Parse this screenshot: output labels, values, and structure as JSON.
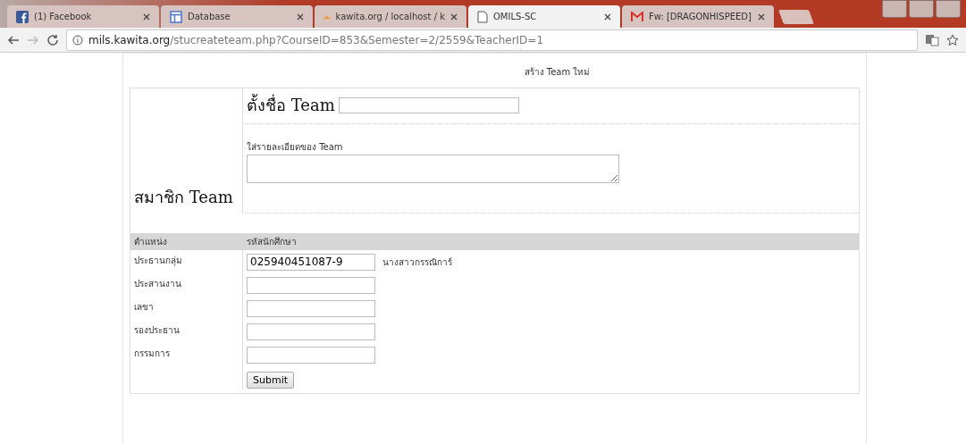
{
  "tabs": [
    {
      "kind": "facebook",
      "title": "(1) Facebook",
      "selected": false
    },
    {
      "kind": "table",
      "title": "Database",
      "selected": false
    },
    {
      "kind": "pma",
      "title": "kawita.org / localhost / k",
      "selected": false
    },
    {
      "kind": "page",
      "title": "OMILS-SC",
      "selected": true
    },
    {
      "kind": "mail",
      "title": "Fw: [DRAGONHISPEED]",
      "selected": false
    }
  ],
  "address": {
    "host": "mils.kawita.org",
    "path": "/stucreateteam.php?CourseID=853&Semester=2/2559&TeacherID=1"
  },
  "page": {
    "heading": "สร้าง Team ใหม่",
    "members_title": "สมาชิก Team",
    "team_name_label": "ตั้งชื่อ Team",
    "description_label": "ใส่รายละเอียดของ Team",
    "columns": [
      "ตำแหน่ง",
      "รหัสนักศึกษา"
    ],
    "members": [
      {
        "role": "ประธานกลุ่ม",
        "student_id": "025940451087-9",
        "name": "นางสาวกรรณิการ์"
      },
      {
        "role": "ประสานงาน"
      },
      {
        "role": "เลขา"
      },
      {
        "role": "รองประธาน"
      },
      {
        "role": "กรรมการ"
      }
    ],
    "submit": "Submit"
  }
}
